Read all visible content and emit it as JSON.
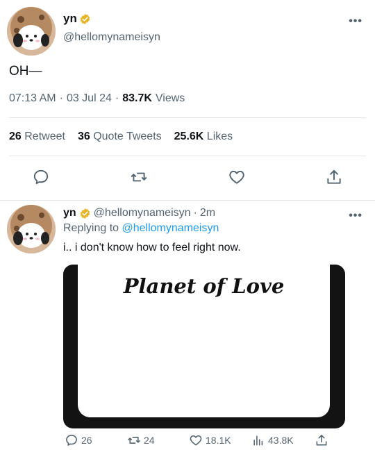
{
  "main_tweet": {
    "display_name": "yn",
    "handle": "@hellomynameisyn",
    "text": "OH—",
    "time": "07:13 AM",
    "date": "03 Jul 24",
    "views_count": "83.7K",
    "views_label": "Views",
    "more": "•••",
    "stats": {
      "retweets_count": "26",
      "retweets_label": "Retweet",
      "quotes_count": "36",
      "quotes_label": "Quote Tweets",
      "likes_count": "25.6K",
      "likes_label": "Likes"
    }
  },
  "reply_tweet": {
    "display_name": "yn",
    "handle": "@hellomynameisyn",
    "time_ago": "2m",
    "replying_label": "Replying to",
    "replying_handle": "@hellomynameisyn",
    "text": "i.. i don't know how to feel right now.",
    "media_title": "Planet of Love",
    "more": "•••",
    "actions": {
      "replies": "26",
      "retweets": "24",
      "likes": "18.1K",
      "views": "43.8K"
    }
  },
  "icons": {
    "verified": "verified-badge-icon",
    "reply": "comment-icon",
    "retweet": "retweet-icon",
    "like": "heart-icon",
    "share": "share-icon",
    "views": "bar-chart-icon"
  },
  "colors": {
    "verified": "#e8b428",
    "link": "#1d9bf0",
    "secondary_text": "#536471",
    "icon": "#536471"
  }
}
